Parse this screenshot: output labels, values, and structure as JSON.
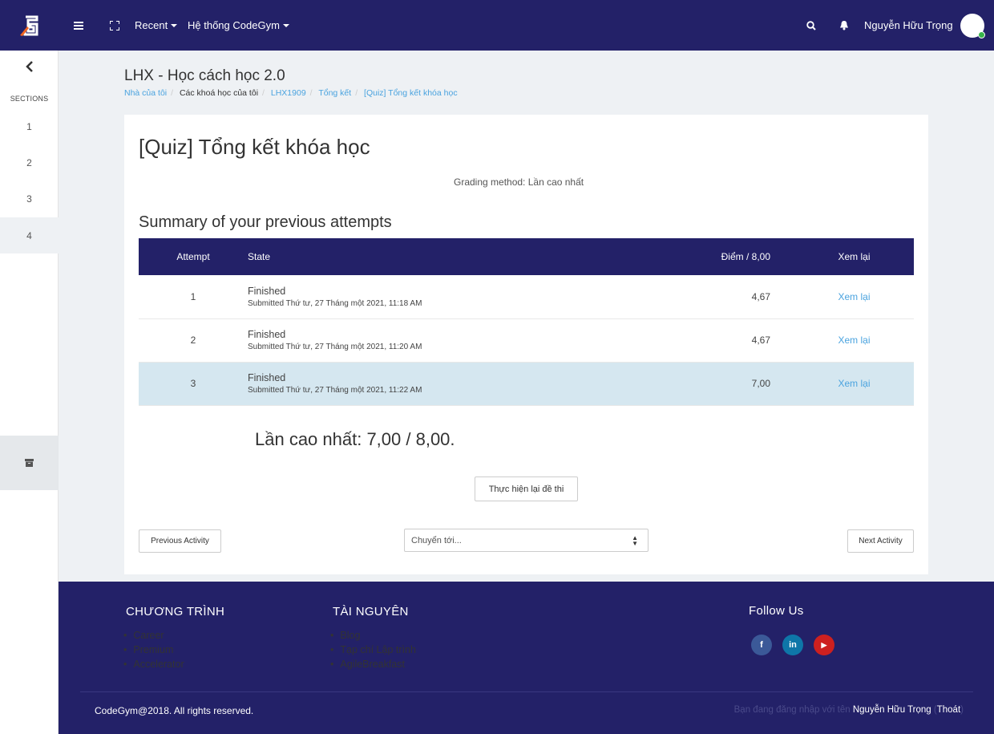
{
  "nav": {
    "recent_label": "Recent",
    "system_label": "Hệ thống CodeGym",
    "user_name": "Nguyễn Hữu Trọng"
  },
  "drawer": {
    "title": "SECTIONS",
    "sections": [
      "1",
      "2",
      "3",
      "4"
    ],
    "active_section": "4"
  },
  "page": {
    "course_title": "LHX - Học cách học 2.0",
    "breadcrumb": [
      "Nhà của tôi",
      "Các khoá học của tôi",
      "LHX1909",
      "Tổng kết",
      "[Quiz] Tổng kết khóa học"
    ]
  },
  "quiz": {
    "title": "[Quiz] Tổng kết khóa học",
    "grading_method": "Grading method: Lần cao nhất",
    "summary_heading": "Summary of your previous attempts",
    "columns": {
      "attempt": "Attempt",
      "state": "State",
      "grade": "Điểm / 8,00",
      "review": "Xem lại"
    },
    "attempts": [
      {
        "attempt": "1",
        "state": "Finished",
        "submitted": "Submitted Thứ tư, 27 Tháng một 2021, 11:18 AM",
        "grade": "4,67",
        "review": "Xem lại"
      },
      {
        "attempt": "2",
        "state": "Finished",
        "submitted": "Submitted Thứ tư, 27 Tháng một 2021, 11:20 AM",
        "grade": "4,67",
        "review": "Xem lại"
      },
      {
        "attempt": "3",
        "state": "Finished",
        "submitted": "Submitted Thứ tư, 27 Tháng một 2021, 11:22 AM",
        "grade": "7,00",
        "review": "Xem lại"
      }
    ],
    "highest_grade": "Lần cao nhất: 7,00 / 8,00.",
    "retake_button": "Thực hiện lại đề thi",
    "prev_button": "Previous Activity",
    "jump_placeholder": "Chuyển tới...",
    "next_button": "Next Activity"
  },
  "footer": {
    "program_heading": "CHƯƠNG TRÌNH",
    "program_items": [
      "Career",
      "Premium",
      "Accelerator"
    ],
    "resources_heading": "TÀI NGUYÊN",
    "resources_items": [
      "Blog",
      "Tạp chí Lập trình",
      "AgileBreakfast"
    ],
    "follow_heading": "Follow Us",
    "social": [
      {
        "icon": "facebook-icon",
        "glyph": "f",
        "color": "#3b5998"
      },
      {
        "icon": "linkedin-icon",
        "glyph": "in",
        "color": "#0e76a8"
      },
      {
        "icon": "youtube-icon",
        "glyph": "▶",
        "color": "#cd201f"
      }
    ],
    "copyright": "CodeGym@2018. All rights reserved.",
    "logged_in_prefix": "Bạn đang đăng nhập với tên ",
    "logged_in_name": "Nguyễn Hữu Trọng",
    "logout": "Thoát"
  },
  "colors": {
    "brand": "#232168",
    "link": "#4aa3df",
    "highlight_row": "#d5e7f0",
    "logo_orange": "#f26522"
  }
}
